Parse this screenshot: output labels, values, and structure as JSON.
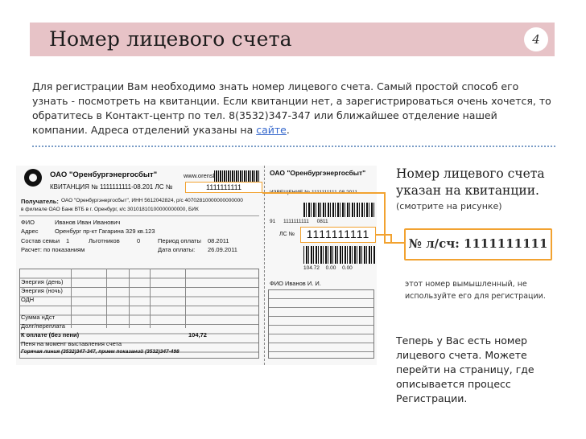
{
  "slide": {
    "title": "Номер лицевого счета",
    "page_number": "4"
  },
  "intro": {
    "text_before_link": "Для регистрации Вам необходимо знать номер лицевого счета. Самый простой способ его узнать - посмотреть на квитанции. Если квитанции нет, а зарегистрироваться очень хочется, то обратитесь в Контакт-центр по тел. 8(3532)347-347 или ближайшее отделение нашей компании. Адреса отделений указаны на ",
    "link_text": "сайте",
    "text_after_link": "."
  },
  "receipt": {
    "company": "ОАО \"Оренбургэнергосбыт\"",
    "site": "www.orensbyt.ru",
    "receipt_title": "КВИТАНЦИЯ № 1111111111-08.201  ЛС №",
    "account_top": "1111111111",
    "payer_label": "Получатель:",
    "payer_value": "ОАО \"Оренбургэнергосбыт\", ИНН 5612042824, р/с 40702810000000000000",
    "bank": "в филиале ОАО Банк ВТБ в г. Оренбург, к/с 30101810100000000000, БИК",
    "fio_label": "ФИО",
    "fio_value": "Иванов Иван Иванович",
    "address_label": "Адрес",
    "address_value": "Оренбург пр-кт Гагарина 329 кв.123",
    "family_label": "Состав семьи",
    "family_value": "1",
    "benefit_label": "Льготников",
    "benefit_value": "0",
    "period_label": "Период оплаты",
    "period_value": "08.2011",
    "calc_label": "Расчет: по показаниям",
    "calc_date_label": "Дата оплаты:",
    "calc_date_value": "26.09.2011",
    "rows": [
      "Энергия (день)",
      "Энергия (ночь)",
      "ОДН",
      "Сумма нДст",
      "Долг/переплата",
      "К оплате (без пени)",
      "Пеня на момент выставления счета"
    ],
    "total": "104,72",
    "hotline": "Горячая линия (3532)347-347, прием показаний (3532)347-498",
    "right_company": "ОАО \"Оренбургэнергосбыт\"",
    "notice": "ИЗВЕЩЕНИЕ №  1111111111-08.2011",
    "right_codes": "91  1111111111  0811",
    "right_ls": "ЛС №",
    "right_account": "1111111111",
    "right_sum": "104.72  0.00  0.00",
    "right_fio": "ФИО  Иванов И. И."
  },
  "side": {
    "title": "Номер лицевого счета указан на квитанции.",
    "hint": "(смотрите на рисунке)",
    "account_badge": "№ л/сч: 1111111111",
    "fake_note": "этот номер вымышленный, не используйте его для регистрации.",
    "after_text": "Теперь у Вас есть номер лицевого счета. Можете перейти на страницу, где описывается процесс Регистрации."
  },
  "colors": {
    "header_bg": "#e7c3c7",
    "highlight": "#f2a230",
    "link": "#3366cc",
    "divider": "#7a9cc6"
  }
}
